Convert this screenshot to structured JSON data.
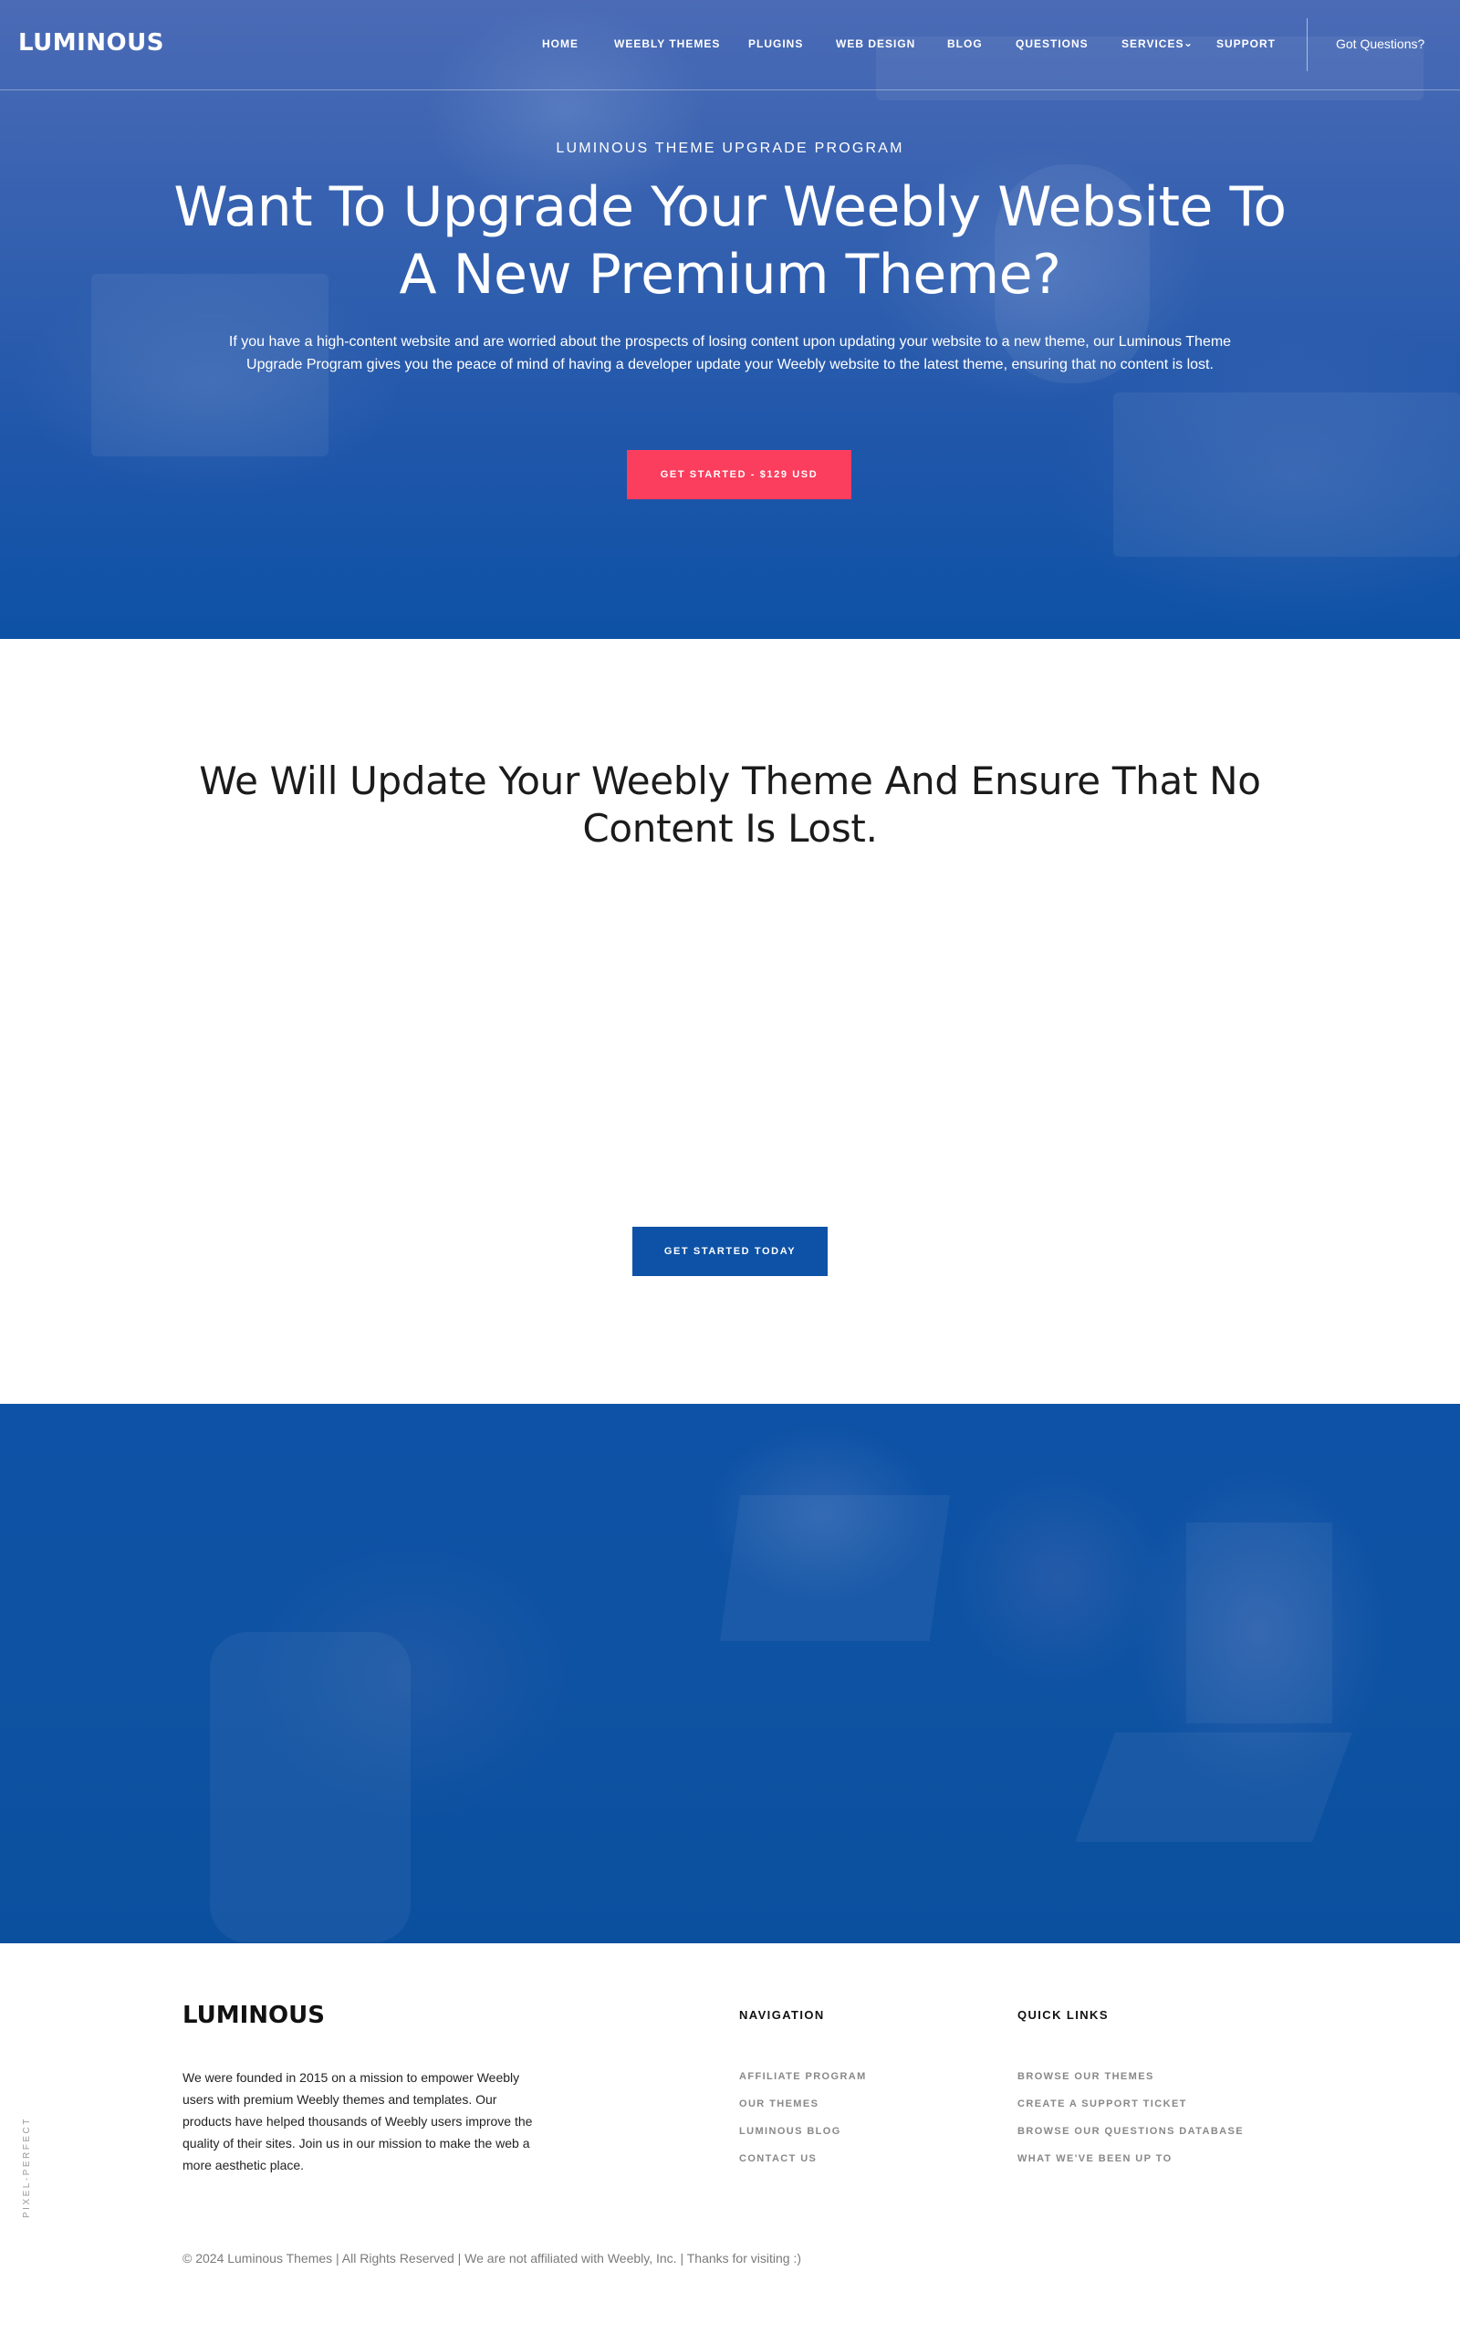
{
  "header": {
    "logo": "LUMINOUS",
    "nav": [
      {
        "label": "HOME"
      },
      {
        "label": "WEEBLY THEMES"
      },
      {
        "label": "PLUGINS"
      },
      {
        "label": "WEB DESIGN"
      },
      {
        "label": "BLOG"
      },
      {
        "label": "QUESTIONS"
      },
      {
        "label": "SERVICES",
        "has_dropdown": true
      },
      {
        "label": "SUPPORT"
      }
    ],
    "cta_link": "Got Questions?"
  },
  "hero": {
    "eyebrow": "LUMINOUS THEME UPGRADE PROGRAM",
    "title": "Want To Upgrade Your Weebly Website To A New Premium Theme?",
    "body": "If you have a high-content website and are worried about the prospects of losing content upon updating your website to a new theme, our Luminous Theme Upgrade Program gives you the peace of mind of having a developer update your Weebly website to the latest theme, ensuring that no content is lost.",
    "button": "GET STARTED - $129 USD"
  },
  "section": {
    "title": "We Will Update Your Weebly Theme And Ensure That No Content Is Lost.",
    "button": "GET STARTED TODAY"
  },
  "footer": {
    "logo": "LUMINOUS",
    "about": "We were founded in 2015 on a mission to empower Weebly users with premium Weebly themes and templates. Our products have helped thousands of Weebly users improve the quality of their sites. Join us in our mission to make the web a more aesthetic place.",
    "navigation": {
      "title": "NAVIGATION",
      "links": [
        "AFFILIATE PROGRAM",
        "OUR THEMES",
        "LUMINOUS BLOG",
        "CONTACT US"
      ]
    },
    "quick_links": {
      "title": "QUICK LINKS",
      "links": [
        "BROWSE OUR THEMES",
        "CREATE A SUPPORT TICKET",
        "BROWSE OUR QUESTIONS DATABASE",
        "WHAT WE'VE BEEN UP TO"
      ]
    },
    "side_tag": "PIXEL-PERFECT",
    "copyright": "© 2024 Luminous Themes | All Rights Reserved | We are not affiliated with Weebly, Inc. | Thanks for visiting :)"
  },
  "colors": {
    "primary_blue": "#0d52a6",
    "accent_red": "#fb3e5e"
  }
}
